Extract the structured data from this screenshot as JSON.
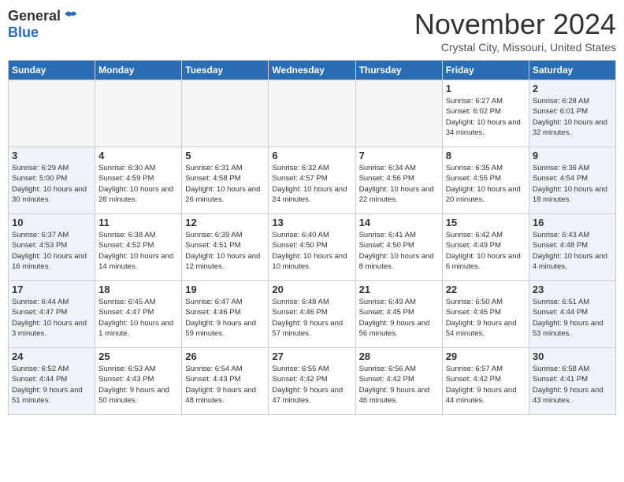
{
  "header": {
    "logo_general": "General",
    "logo_blue": "Blue",
    "month": "November 2024",
    "location": "Crystal City, Missouri, United States"
  },
  "days_of_week": [
    "Sunday",
    "Monday",
    "Tuesday",
    "Wednesday",
    "Thursday",
    "Friday",
    "Saturday"
  ],
  "weeks": [
    [
      {
        "day": "",
        "empty": true
      },
      {
        "day": "",
        "empty": true
      },
      {
        "day": "",
        "empty": true
      },
      {
        "day": "",
        "empty": true
      },
      {
        "day": "",
        "empty": true
      },
      {
        "day": "1",
        "sunrise": "6:27 AM",
        "sunset": "6:02 PM",
        "daylight": "Daylight: 10 hours and 34 minutes."
      },
      {
        "day": "2",
        "sunrise": "6:28 AM",
        "sunset": "6:01 PM",
        "daylight": "Daylight: 10 hours and 32 minutes."
      }
    ],
    [
      {
        "day": "3",
        "sunrise": "6:29 AM",
        "sunset": "5:00 PM",
        "daylight": "Daylight: 10 hours and 30 minutes."
      },
      {
        "day": "4",
        "sunrise": "6:30 AM",
        "sunset": "4:59 PM",
        "daylight": "Daylight: 10 hours and 28 minutes."
      },
      {
        "day": "5",
        "sunrise": "6:31 AM",
        "sunset": "4:58 PM",
        "daylight": "Daylight: 10 hours and 26 minutes."
      },
      {
        "day": "6",
        "sunrise": "6:32 AM",
        "sunset": "4:57 PM",
        "daylight": "Daylight: 10 hours and 24 minutes."
      },
      {
        "day": "7",
        "sunrise": "6:34 AM",
        "sunset": "4:56 PM",
        "daylight": "Daylight: 10 hours and 22 minutes."
      },
      {
        "day": "8",
        "sunrise": "6:35 AM",
        "sunset": "4:55 PM",
        "daylight": "Daylight: 10 hours and 20 minutes."
      },
      {
        "day": "9",
        "sunrise": "6:36 AM",
        "sunset": "4:54 PM",
        "daylight": "Daylight: 10 hours and 18 minutes."
      }
    ],
    [
      {
        "day": "10",
        "sunrise": "6:37 AM",
        "sunset": "4:53 PM",
        "daylight": "Daylight: 10 hours and 16 minutes."
      },
      {
        "day": "11",
        "sunrise": "6:38 AM",
        "sunset": "4:52 PM",
        "daylight": "Daylight: 10 hours and 14 minutes."
      },
      {
        "day": "12",
        "sunrise": "6:39 AM",
        "sunset": "4:51 PM",
        "daylight": "Daylight: 10 hours and 12 minutes."
      },
      {
        "day": "13",
        "sunrise": "6:40 AM",
        "sunset": "4:50 PM",
        "daylight": "Daylight: 10 hours and 10 minutes."
      },
      {
        "day": "14",
        "sunrise": "6:41 AM",
        "sunset": "4:50 PM",
        "daylight": "Daylight: 10 hours and 8 minutes."
      },
      {
        "day": "15",
        "sunrise": "6:42 AM",
        "sunset": "4:49 PM",
        "daylight": "Daylight: 10 hours and 6 minutes."
      },
      {
        "day": "16",
        "sunrise": "6:43 AM",
        "sunset": "4:48 PM",
        "daylight": "Daylight: 10 hours and 4 minutes."
      }
    ],
    [
      {
        "day": "17",
        "sunrise": "6:44 AM",
        "sunset": "4:47 PM",
        "daylight": "Daylight: 10 hours and 3 minutes."
      },
      {
        "day": "18",
        "sunrise": "6:45 AM",
        "sunset": "4:47 PM",
        "daylight": "Daylight: 10 hours and 1 minute."
      },
      {
        "day": "19",
        "sunrise": "6:47 AM",
        "sunset": "4:46 PM",
        "daylight": "Daylight: 9 hours and 59 minutes."
      },
      {
        "day": "20",
        "sunrise": "6:48 AM",
        "sunset": "4:46 PM",
        "daylight": "Daylight: 9 hours and 57 minutes."
      },
      {
        "day": "21",
        "sunrise": "6:49 AM",
        "sunset": "4:45 PM",
        "daylight": "Daylight: 9 hours and 56 minutes."
      },
      {
        "day": "22",
        "sunrise": "6:50 AM",
        "sunset": "4:45 PM",
        "daylight": "Daylight: 9 hours and 54 minutes."
      },
      {
        "day": "23",
        "sunrise": "6:51 AM",
        "sunset": "4:44 PM",
        "daylight": "Daylight: 9 hours and 53 minutes."
      }
    ],
    [
      {
        "day": "24",
        "sunrise": "6:52 AM",
        "sunset": "4:44 PM",
        "daylight": "Daylight: 9 hours and 51 minutes."
      },
      {
        "day": "25",
        "sunrise": "6:53 AM",
        "sunset": "4:43 PM",
        "daylight": "Daylight: 9 hours and 50 minutes."
      },
      {
        "day": "26",
        "sunrise": "6:54 AM",
        "sunset": "4:43 PM",
        "daylight": "Daylight: 9 hours and 48 minutes."
      },
      {
        "day": "27",
        "sunrise": "6:55 AM",
        "sunset": "4:42 PM",
        "daylight": "Daylight: 9 hours and 47 minutes."
      },
      {
        "day": "28",
        "sunrise": "6:56 AM",
        "sunset": "4:42 PM",
        "daylight": "Daylight: 9 hours and 46 minutes."
      },
      {
        "day": "29",
        "sunrise": "6:57 AM",
        "sunset": "4:42 PM",
        "daylight": "Daylight: 9 hours and 44 minutes."
      },
      {
        "day": "30",
        "sunrise": "6:58 AM",
        "sunset": "4:41 PM",
        "daylight": "Daylight: 9 hours and 43 minutes."
      }
    ]
  ]
}
